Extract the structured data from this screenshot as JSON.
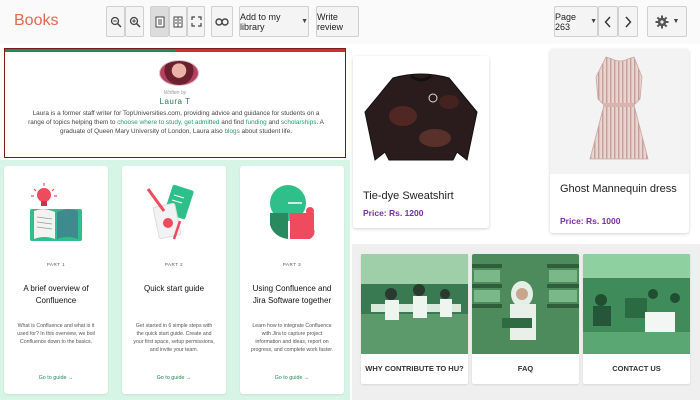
{
  "toolbar": {
    "brand": "Books",
    "add_library": "Add to my library",
    "write_review": "Write review",
    "page": "Page 263",
    "icons": [
      "zoom-out-icon",
      "zoom-in-icon",
      "single-page-icon",
      "two-page-icon",
      "fullscreen-icon",
      "link-icon",
      "settings-icon"
    ]
  },
  "author": {
    "written_by": "Written by",
    "name": "Laura T",
    "bio_1": "Laura is a former staff writer for TopUniversities.com, providing advice and guidance for students on a range of topics helping them to ",
    "bio_link_1": "choose where to study, get admitted",
    "bio_2": " and find ",
    "bio_link_2": "funding",
    "bio_3": " and ",
    "bio_link_3": "scholarships",
    "bio_4": ". A graduate of Queen Mary University of London, Laura also ",
    "bio_link_4": "blogs",
    "bio_5": " about student life."
  },
  "guides": [
    {
      "part": "PART 1",
      "title": "A brief overview of Confluence",
      "desc": "What is Confluence and what is it used for? In this overview, we boil Confluence down to the basics.",
      "link": "Go to guide →"
    },
    {
      "part": "PART 2",
      "title": "Quick start guide",
      "desc": "Get started in 6 simple steps with the quick start guide. Create and your first space, setup permissions, and invite your team.",
      "link": "Go to guide →"
    },
    {
      "part": "PART 3",
      "title": "Using Confluence and Jira Software together",
      "desc": "Learn how to integrate Confluence with Jira to capture project information and ideas, report on progress, and complete work faster.",
      "link": "Go to guide →"
    }
  ],
  "products": [
    {
      "name": "Tie-dye Sweatshirt",
      "price": "Price: Rs. 1200"
    },
    {
      "name": "Ghost Mannequin dress",
      "price": "Price: Rs. 1000"
    }
  ],
  "tiles": [
    {
      "label": "WHY CONTRIBUTE TO HU?"
    },
    {
      "label": "FAQ"
    },
    {
      "label": "CONTACT US"
    }
  ],
  "colors": {
    "brand": "#e06a4e",
    "accent_green": "#1f8a57",
    "price": "#7a2ca8",
    "guide_bg": "#d7f5e6"
  }
}
